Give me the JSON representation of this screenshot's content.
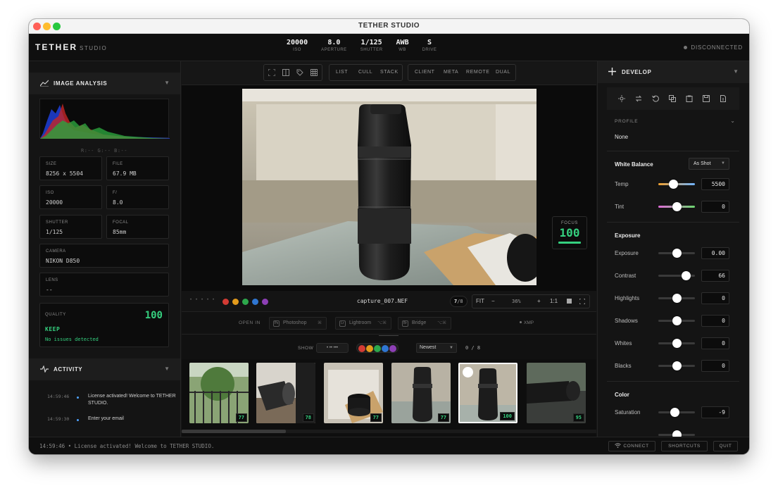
{
  "window": {
    "title": "TETHER STUDIO"
  },
  "header": {
    "brand": "TETHER",
    "brand_sub": "STUDIO",
    "stats": [
      {
        "value": "20000",
        "label": "ISO"
      },
      {
        "value": "8.0",
        "label": "APERTURE"
      },
      {
        "value": "1/125",
        "label": "SHUTTER"
      },
      {
        "value": "AWB",
        "label": "WB"
      },
      {
        "value": "S",
        "label": "DRIVE"
      }
    ],
    "connection": "DISCONNECTED"
  },
  "left": {
    "analysis_title": "IMAGE ANALYSIS",
    "rgb_readout": "R:-- G:-- B:--",
    "cells": {
      "size_label": "SIZE",
      "size_value": "8256 x 5504",
      "file_label": "FILE",
      "file_value": "67.9 MB",
      "iso_label": "ISO",
      "iso_value": "20000",
      "f_label": "F/",
      "f_value": "8.0",
      "shutter_label": "SHUTTER",
      "shutter_value": "1/125",
      "focal_label": "FOCAL",
      "focal_value": "85mm",
      "camera_label": "CAMERA",
      "camera_value": "NIKON D850",
      "lens_label": "LENS",
      "lens_value": "--"
    },
    "quality": {
      "label": "QUALITY",
      "score": "100",
      "verdict": "KEEP",
      "note": "No issues detected"
    },
    "activity_title": "ACTIVITY",
    "activity": [
      {
        "time": "14:59:46",
        "message": "License activated! Welcome to TETHER STUDIO."
      },
      {
        "time": "14:59:30",
        "message": "Enter your email"
      }
    ]
  },
  "toolbar": {
    "view_modes": [
      "LIST",
      "CULL",
      "STACK"
    ],
    "panels": [
      "CLIENT",
      "META",
      "REMOTE",
      "DUAL"
    ]
  },
  "viewer": {
    "focus_label": "FOCUS",
    "focus_value": "100"
  },
  "infobar": {
    "stars": [
      "•",
      "•",
      "•",
      "•",
      "•"
    ],
    "label_colors": [
      "#d33b34",
      "#e39b1c",
      "#2da84c",
      "#2f76d2",
      "#8d3fb5"
    ],
    "filename": "capture_007.NEF",
    "counter_current": "7",
    "counter_total": "/8",
    "zoom": {
      "fit": "FIT",
      "minus": "−",
      "value": "36%",
      "plus": "+",
      "one_to_one": "1:1"
    }
  },
  "open_in": {
    "label": "OPEN IN",
    "apps": [
      {
        "icon": "Ps",
        "name": "Photoshop",
        "key": "⌘"
      },
      {
        "icon": "Lr",
        "name": "Lightroom",
        "key": "⌥⌘"
      },
      {
        "icon": "Br",
        "name": "Bridge",
        "key": "⌥⌘"
      }
    ],
    "xmp": "XMP"
  },
  "filter": {
    "show_label": "SHOW",
    "star_filter": "• •• •••",
    "sort": "Newest",
    "count": "0 / 8"
  },
  "filmstrip": {
    "selected_index": 4,
    "thumbs": [
      {
        "score": "77"
      },
      {
        "score": "78"
      },
      {
        "score": "77"
      },
      {
        "score": "77"
      },
      {
        "score": "100"
      },
      {
        "score": "95"
      }
    ]
  },
  "develop": {
    "title": "DEVELOP",
    "profile_label": "PROFILE",
    "profile_value": "None",
    "wb_title": "White Balance",
    "wb_select": "As Shot",
    "temp_label": "Temp",
    "temp_value": "5500",
    "temp_pos": 0.42,
    "tint_label": "Tint",
    "tint_value": "0",
    "tint_pos": 0.5,
    "exposure_title": "Exposure",
    "sliders": [
      {
        "label": "Exposure",
        "value": "0.00",
        "pos": 0.5
      },
      {
        "label": "Contrast",
        "value": "66",
        "pos": 0.75
      },
      {
        "label": "Highlights",
        "value": "0",
        "pos": 0.5
      },
      {
        "label": "Shadows",
        "value": "0",
        "pos": 0.5
      },
      {
        "label": "Whites",
        "value": "0",
        "pos": 0.5
      },
      {
        "label": "Blacks",
        "value": "0",
        "pos": 0.5
      }
    ],
    "color_title": "Color",
    "saturation_label": "Saturation",
    "saturation_value": "-9",
    "saturation_pos": 0.46
  },
  "statusbar": {
    "message": "14:59:46 • License activated! Welcome to TETHER STUDIO.",
    "connect": "CONNECT",
    "shortcuts": "SHORTCUTS",
    "quit": "QUIT"
  }
}
